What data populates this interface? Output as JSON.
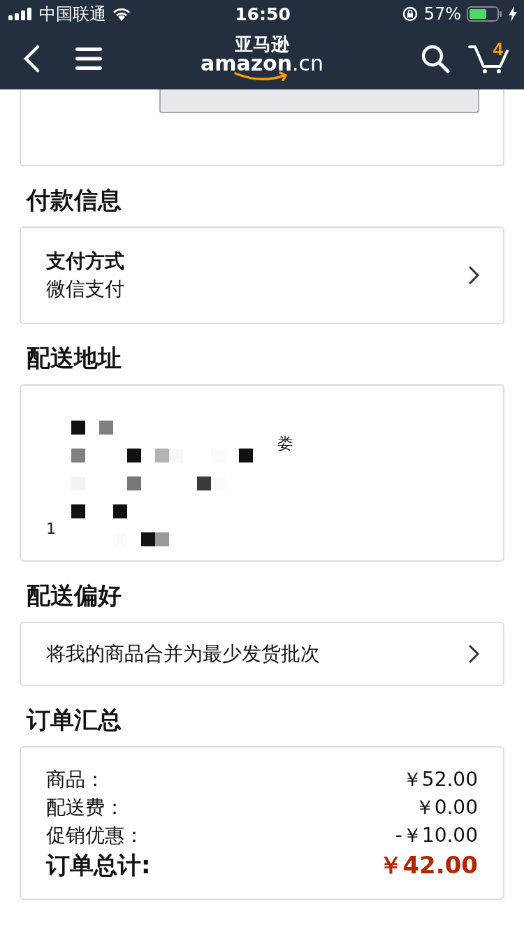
{
  "status_bar": {
    "carrier": "中国联通",
    "time": "16:50",
    "battery": "57%",
    "charging": true
  },
  "nav": {
    "logo_cn": "亚马逊",
    "logo": "amazon",
    "logo_suffix": ".cn",
    "cart_count": "4"
  },
  "payment": {
    "title": "付款信息",
    "label": "支付方式",
    "value": "微信支付"
  },
  "address": {
    "title": "配送地址",
    "fragments": [
      "娄",
      "1"
    ]
  },
  "preference": {
    "title": "配送偏好",
    "value": "将我的商品合并为最少发货批次"
  },
  "summary": {
    "title": "订单汇总",
    "rows": [
      {
        "label": "商品：",
        "amount": "￥52.00"
      },
      {
        "label": "配送费：",
        "amount": "￥0.00"
      },
      {
        "label": "促销优惠：",
        "amount": "-￥10.00"
      }
    ],
    "total": {
      "label": "订单总计:",
      "amount": "￥42.00"
    }
  }
}
